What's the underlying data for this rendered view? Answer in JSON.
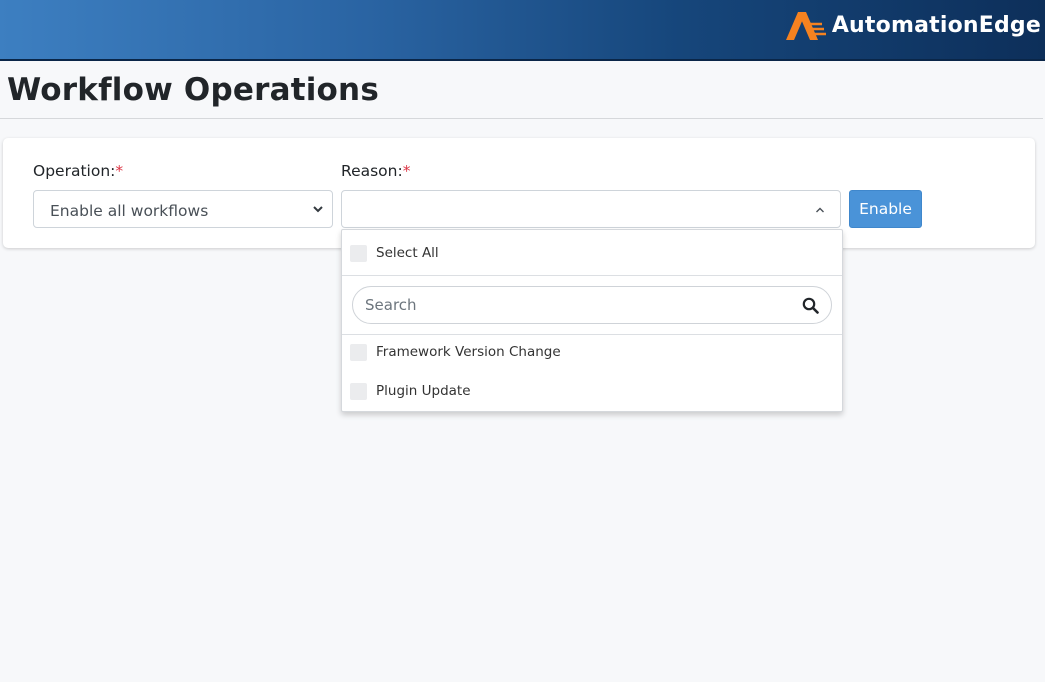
{
  "header": {
    "brand": "AutomationEdge",
    "colors": {
      "gradient_start": "#3d7fc1",
      "gradient_end": "#0d2f5a",
      "logo_mark": "#f58220"
    }
  },
  "page": {
    "title": "Workflow Operations"
  },
  "form": {
    "operation_label": "Operation:",
    "reason_label": "Reason:",
    "required_mark": "*",
    "operation_value": "Enable all workflows",
    "reason_value": "",
    "enable_button": "Enable"
  },
  "dropdown": {
    "select_all": "Select All",
    "search_placeholder": "Search",
    "options": [
      {
        "label": "Framework Version Change"
      },
      {
        "label": "Plugin Update"
      }
    ]
  },
  "icons": {
    "operation_chevron": "chevron-down-icon",
    "reason_chevron": "chevron-up-icon",
    "search": "search-icon",
    "logo": "automationedge-logo-icon"
  },
  "accent": {
    "button": "#4a93d8",
    "required": "#dc3545"
  }
}
